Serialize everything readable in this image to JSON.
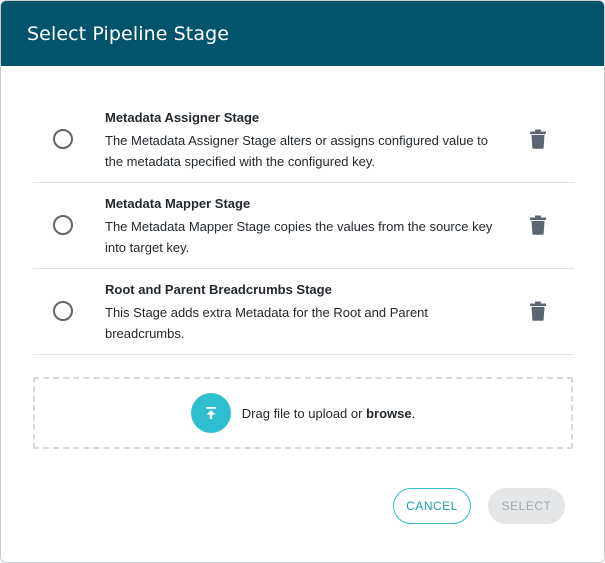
{
  "dialog": {
    "title": "Select Pipeline Stage"
  },
  "stages": [
    {
      "title": "Metadata Assigner Stage",
      "description_line1": "The Metadata Assigner Stage alters or assigns configured value to",
      "description_line2": "the metadata specified with the configured key.",
      "selected": false
    },
    {
      "title": "Metadata Mapper Stage",
      "description_line1": "The Metadata Mapper Stage copies the values from the source key",
      "description_line2": "into target key.",
      "selected": false
    },
    {
      "title": "Root and Parent Breadcrumbs Stage",
      "description_line1": "This Stage adds extra Metadata for the Root and Parent",
      "description_line2": "breadcrumbs.",
      "selected": false
    }
  ],
  "upload": {
    "prompt": "Drag file to upload or ",
    "browse_label": "browse",
    "suffix": ".",
    "icon": "upload-icon"
  },
  "actions": {
    "cancel_label": "CANCEL",
    "select_label": "SELECT",
    "select_disabled": true
  },
  "colors": {
    "header_bg": "#03536b",
    "accent": "#2dbfcf",
    "disabled_bg": "#e4e6e8"
  }
}
